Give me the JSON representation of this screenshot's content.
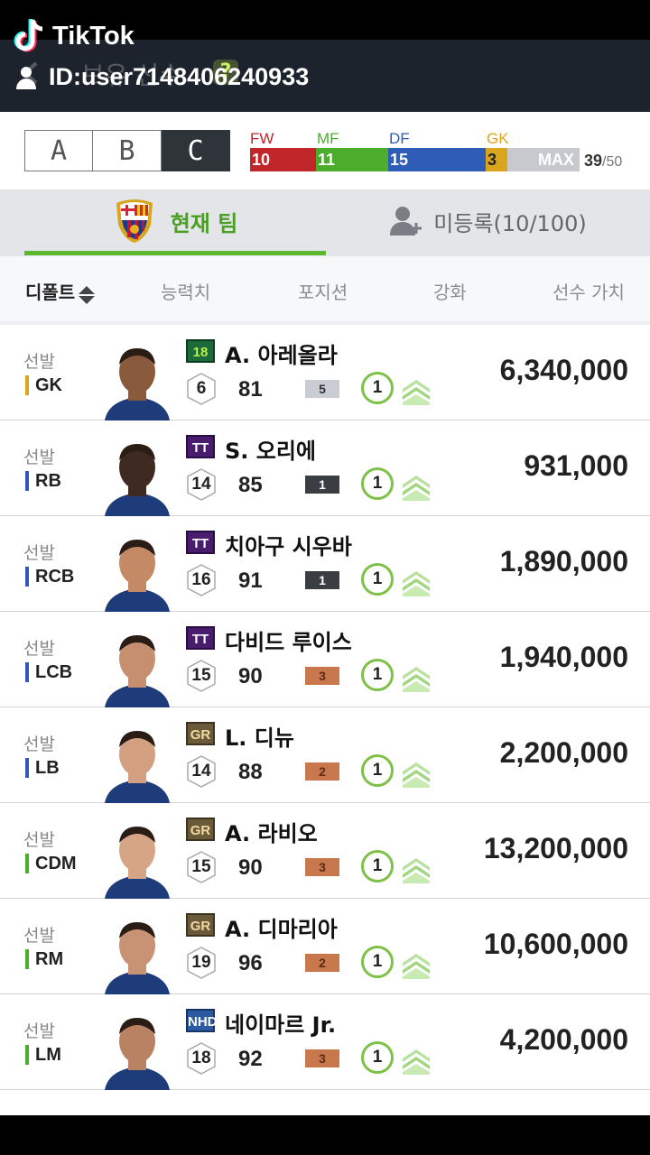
{
  "overlay": {
    "brand": "TikTok",
    "user_id": "ID:user7148406240933"
  },
  "header": {
    "title": "보유 선수",
    "help": "?"
  },
  "squads": [
    {
      "label": "A"
    },
    {
      "label": "B"
    },
    {
      "label": "C",
      "active": true
    }
  ],
  "position_bar": {
    "segments": [
      {
        "label": "FW",
        "count": "10",
        "color": "#c0262a"
      },
      {
        "label": "MF",
        "count": "11",
        "color": "#4bad2b"
      },
      {
        "label": "DF",
        "count": "15",
        "color": "#2f5cb7"
      },
      {
        "label": "GK",
        "count": "3",
        "color": "#d9a51c"
      }
    ],
    "max_label": "MAX",
    "current": "39",
    "max": "/50"
  },
  "tabs": {
    "current_team": "현재 팀",
    "unregistered": "미등록(10/100)"
  },
  "sort": {
    "default": "디폴트",
    "ability": "능력치",
    "position": "포지션",
    "enhance": "강화",
    "value": "선수 가치"
  },
  "players": [
    {
      "status": "선발",
      "position": "GK",
      "pos_color": "#d9a51c",
      "card": "18",
      "card_style": "c18",
      "name": "A. 아레올라",
      "salary": "6",
      "ovr": "81",
      "grade": "5",
      "grade_style": "silver",
      "level": "1",
      "value": "6,340,000",
      "skin": "#8a5a3c"
    },
    {
      "status": "선발",
      "position": "RB",
      "pos_color": "#2e59b8",
      "card": "TT",
      "card_style": "tt",
      "name": "S. 오리에",
      "salary": "14",
      "ovr": "85",
      "grade": "1",
      "grade_style": "black",
      "level": "1",
      "value": "931,000",
      "skin": "#3e2a20"
    },
    {
      "status": "선발",
      "position": "RCB",
      "pos_color": "#2e59b8",
      "card": "TT",
      "card_style": "tt",
      "name": "치아구 시우바",
      "salary": "16",
      "ovr": "91",
      "grade": "1",
      "grade_style": "black",
      "level": "1",
      "value": "1,890,000",
      "skin": "#c48a66"
    },
    {
      "status": "선발",
      "position": "LCB",
      "pos_color": "#2e59b8",
      "card": "TT",
      "card_style": "tt",
      "name": "다비드 루이스",
      "salary": "15",
      "ovr": "90",
      "grade": "3",
      "grade_style": "bronze",
      "level": "1",
      "value": "1,940,000",
      "skin": "#c69070"
    },
    {
      "status": "선발",
      "position": "LB",
      "pos_color": "#2e59b8",
      "card": "GR",
      "card_style": "gr",
      "name": "L. 디뉴",
      "salary": "14",
      "ovr": "88",
      "grade": "2",
      "grade_style": "bronze",
      "level": "1",
      "value": "2,200,000",
      "skin": "#d2a080"
    },
    {
      "status": "선발",
      "position": "CDM",
      "pos_color": "#4bad2b",
      "card": "GR",
      "card_style": "gr",
      "name": "A. 라비오",
      "salary": "15",
      "ovr": "90",
      "grade": "3",
      "grade_style": "bronze",
      "level": "1",
      "value": "13,200,000",
      "skin": "#d6a586"
    },
    {
      "status": "선발",
      "position": "RM",
      "pos_color": "#4bad2b",
      "card": "GR",
      "card_style": "gr",
      "name": "A. 디마리아",
      "salary": "19",
      "ovr": "96",
      "grade": "2",
      "grade_style": "bronze",
      "level": "1",
      "value": "10,600,000",
      "skin": "#c89274"
    },
    {
      "status": "선발",
      "position": "LM",
      "pos_color": "#4bad2b",
      "card": "NHD",
      "card_style": "nhd",
      "name": "네이마르 Jr.",
      "salary": "18",
      "ovr": "92",
      "grade": "3",
      "grade_style": "bronze",
      "level": "1",
      "value": "4,200,000",
      "skin": "#b98262"
    }
  ]
}
